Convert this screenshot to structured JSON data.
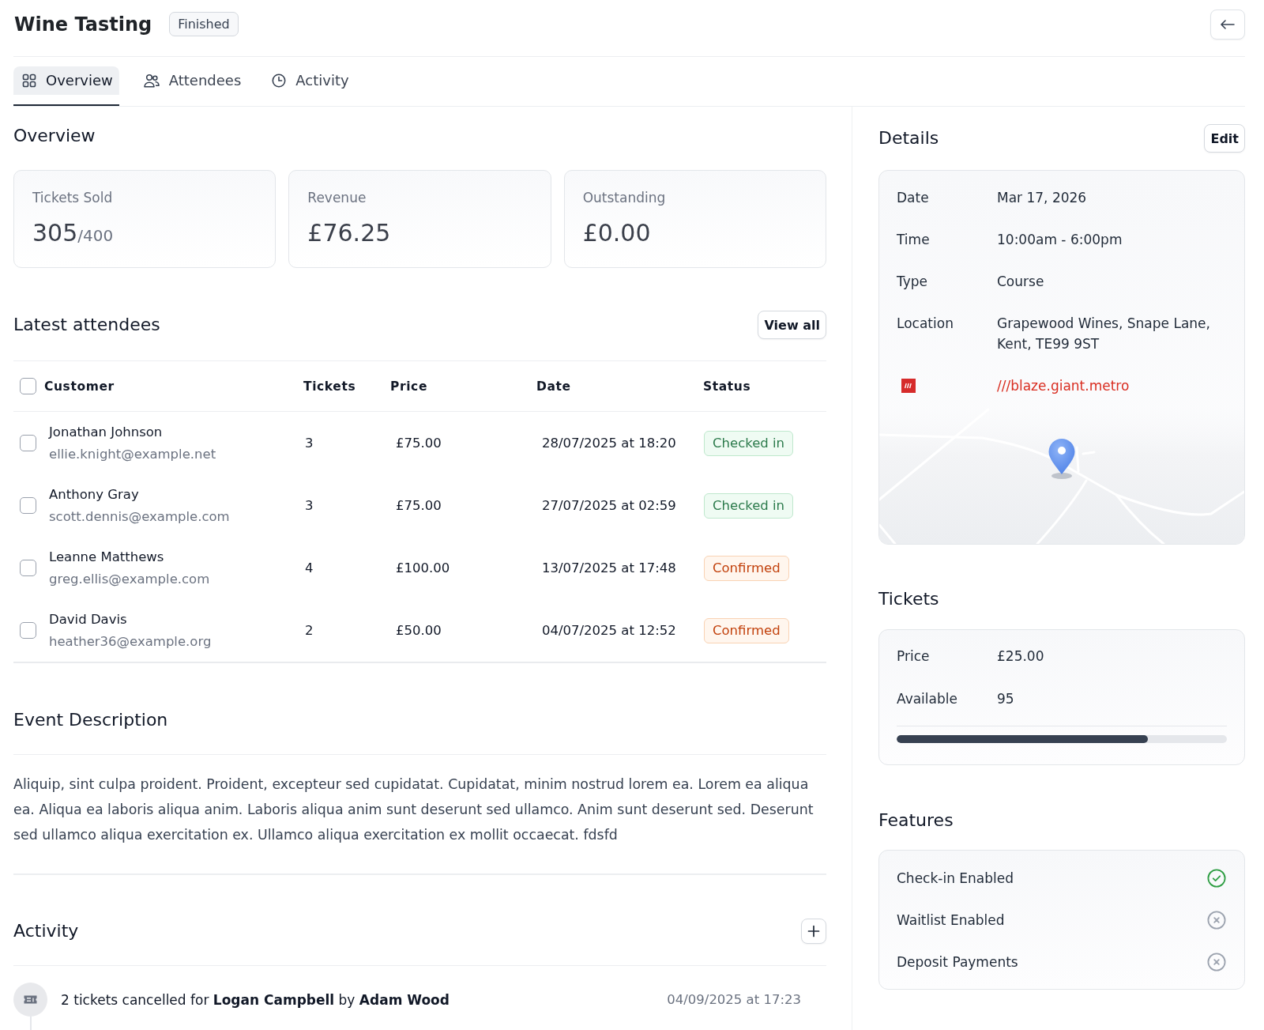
{
  "header": {
    "title": "Wine Tasting",
    "status": "Finished"
  },
  "tabs": [
    {
      "label": "Overview",
      "selected": true
    },
    {
      "label": "Attendees",
      "selected": false
    },
    {
      "label": "Activity",
      "selected": false
    }
  ],
  "overview": {
    "title": "Overview",
    "stats": [
      {
        "label": "Tickets Sold",
        "value": "305",
        "total": "/400"
      },
      {
        "label": "Revenue",
        "value": "£76.25"
      },
      {
        "label": "Outstanding",
        "value": "£0.00"
      }
    ]
  },
  "attendees": {
    "title": "Latest attendees",
    "view_all": "View all",
    "all_selected": false,
    "columns": [
      "Customer",
      "Tickets",
      "Price",
      "Date",
      "Status"
    ],
    "rows": [
      {
        "name": "Jonathan Johnson",
        "email": "ellie.knight@example.net",
        "tickets": "3",
        "price": "£75.00",
        "date": "28/07/2025 at 18:20",
        "status": {
          "text": "Checked in",
          "kind": "success"
        },
        "selected": false
      },
      {
        "name": "Anthony Gray",
        "email": "scott.dennis@example.com",
        "tickets": "3",
        "price": "£75.00",
        "date": "27/07/2025 at 02:59",
        "status": {
          "text": "Checked in",
          "kind": "success"
        },
        "selected": false
      },
      {
        "name": "Leanne Matthews",
        "email": "greg.ellis@example.com",
        "tickets": "4",
        "price": "£100.00",
        "date": "13/07/2025 at 17:48",
        "status": {
          "text": "Confirmed",
          "kind": "warning"
        },
        "selected": false
      },
      {
        "name": "David Davis",
        "email": "heather36@example.org",
        "tickets": "2",
        "price": "£50.00",
        "date": "04/07/2025 at 12:52",
        "status": {
          "text": "Confirmed",
          "kind": "warning"
        },
        "selected": false
      }
    ]
  },
  "description": {
    "title": "Event Description",
    "text": "Aliquip, sint culpa proident. Proident, excepteur sed cupidatat. Cupidatat, minim nostrud lorem ea. Lorem ea aliqua ea. Aliqua ea laboris aliqua anim. Laboris aliqua anim sunt deserunt sed ullamco. Anim sunt deserunt sed. Deserunt sed ullamco aliqua exercitation ex. Ullamco aliqua exercitation ex mollit occaecat. fdsfd"
  },
  "activity": {
    "title": "Activity",
    "items": [
      {
        "text": "2 tickets cancelled for **Logan Campbell** by **Adam Wood**",
        "time": "04/09/2025 at 17:23"
      }
    ]
  },
  "details": {
    "title": "Details",
    "edit": "Edit",
    "rows": [
      {
        "label": "Date",
        "value": "Mar 17, 2026"
      },
      {
        "label": "Time",
        "value": "10:00am - 6:00pm"
      },
      {
        "label": "Type",
        "value": "Course"
      },
      {
        "label": "Location",
        "value": "Grapewood Wines, Snape Lane, Kent, TE99 9ST"
      }
    ],
    "link": "///blaze.giant.metro"
  },
  "tickets": {
    "title": "Tickets",
    "rows": [
      {
        "label": "Price",
        "value": "£25.00"
      },
      {
        "label": "Available",
        "value": "95"
      }
    ],
    "level": 0.76
  },
  "features": {
    "title": "Features",
    "items": [
      {
        "label": "Check-in Enabled",
        "on": true
      },
      {
        "label": "Waitlist Enabled",
        "on": false
      },
      {
        "label": "Deposit Payments",
        "on": false
      }
    ]
  }
}
